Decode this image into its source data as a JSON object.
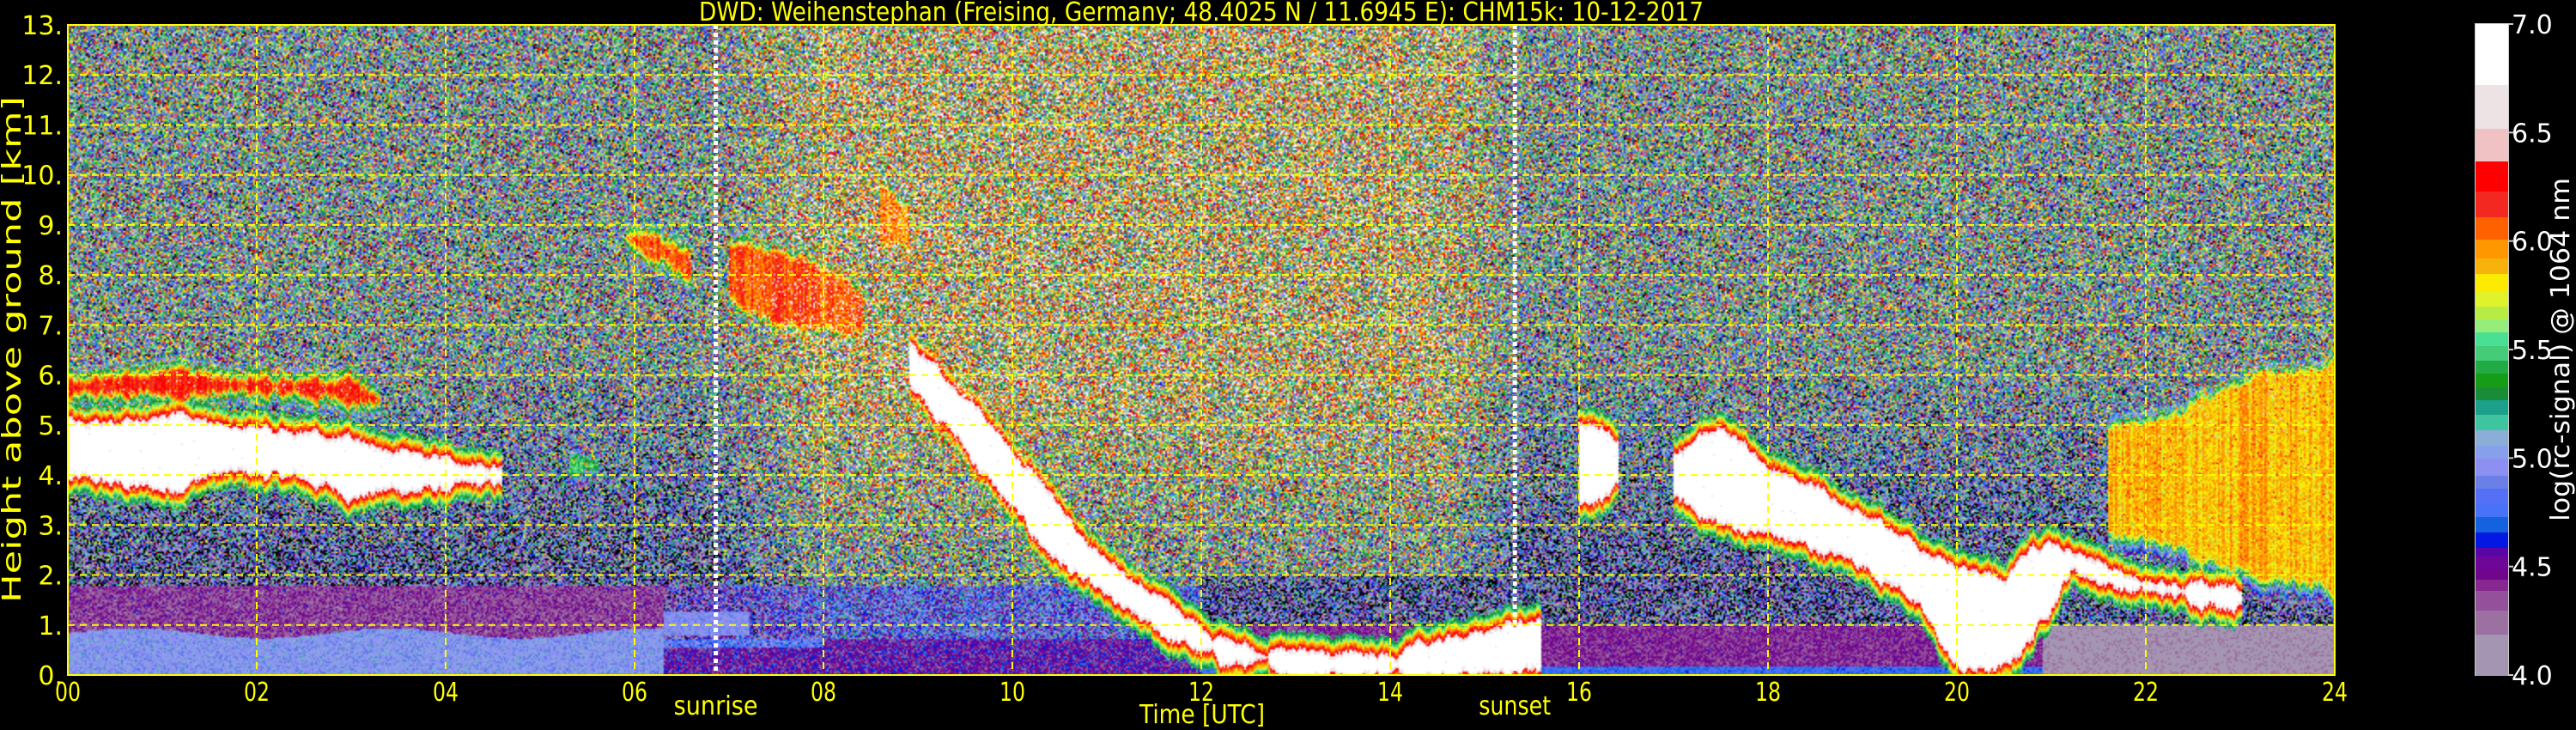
{
  "title": "DWD: Weihenstephan (Freising, Germany; 48.4025 N / 11.6945 E):    CHM15k: 10-12-2017",
  "chart_data": {
    "type": "heatmap",
    "title": "DWD: Weihenstephan (Freising, Germany; 48.4025 N / 11.6945 E):    CHM15k: 10-12-2017",
    "xlabel": "Time [UTC]",
    "ylabel": "Height above ground [km]",
    "xlim": [
      0,
      24
    ],
    "ylim": [
      0,
      13
    ],
    "xticks": [
      "00",
      "02",
      "04",
      "06",
      "08",
      "10",
      "12",
      "14",
      "16",
      "18",
      "20",
      "22",
      "24"
    ],
    "xtick_values": [
      0,
      2,
      4,
      6,
      8,
      10,
      12,
      14,
      16,
      18,
      20,
      22,
      24
    ],
    "yticks": [
      "0.",
      "1.",
      "2.",
      "3.",
      "4.",
      "5.",
      "6.",
      "7.",
      "8.",
      "9.",
      "10.",
      "11.",
      "12.",
      "13."
    ],
    "ytick_values": [
      0,
      1,
      2,
      3,
      4,
      5,
      6,
      7,
      8,
      9,
      10,
      11,
      12,
      13
    ],
    "grid": true,
    "annotations": [
      {
        "label": "sunrise",
        "time": 6.86
      },
      {
        "label": "sunset",
        "time": 15.32
      }
    ],
    "colorbar": {
      "label": "log(rc-signal) @ 1064 nm",
      "range": [
        4.0,
        7.0
      ],
      "ticks": [
        "4.0",
        "4.5",
        "5.0",
        "5.5",
        "6.0",
        "6.5",
        "7.0"
      ],
      "tick_values": [
        4.0,
        4.5,
        5.0,
        5.5,
        6.0,
        6.5,
        7.0
      ],
      "stops": [
        [
          4.0,
          4.19,
          "#a496b2"
        ],
        [
          4.19,
          4.3,
          "#9c70a0"
        ],
        [
          4.3,
          4.39,
          "#94509a"
        ],
        [
          4.39,
          4.44,
          "#862890"
        ],
        [
          4.44,
          4.49,
          "#70068c"
        ],
        [
          4.49,
          4.55,
          "#6e0698"
        ],
        [
          4.55,
          4.59,
          "#5a06a6"
        ],
        [
          4.59,
          4.66,
          "#0418e4"
        ],
        [
          4.66,
          4.73,
          "#1462e0"
        ],
        [
          4.73,
          4.79,
          "#4872f8"
        ],
        [
          4.79,
          4.86,
          "#5470f4"
        ],
        [
          4.86,
          4.92,
          "#6a80e6"
        ],
        [
          4.92,
          5.0,
          "#8c90f0"
        ],
        [
          5.0,
          5.06,
          "#88a0ec"
        ],
        [
          5.06,
          5.13,
          "#8aaed8"
        ],
        [
          5.13,
          5.2,
          "#3fc4a0"
        ],
        [
          5.2,
          5.27,
          "#1ca08a"
        ],
        [
          5.27,
          5.33,
          "#198c38"
        ],
        [
          5.33,
          5.39,
          "#169c16"
        ],
        [
          5.39,
          5.45,
          "#22aa44"
        ],
        [
          5.45,
          5.52,
          "#44cc78"
        ],
        [
          5.52,
          5.58,
          "#4ae094"
        ],
        [
          5.58,
          5.64,
          "#96ee7a"
        ],
        [
          5.64,
          5.7,
          "#b7ec44"
        ],
        [
          5.7,
          5.77,
          "#dff22c"
        ],
        [
          5.77,
          5.85,
          "#fcea00"
        ],
        [
          5.85,
          5.92,
          "#f8b20c"
        ],
        [
          5.92,
          6.01,
          "#ff9800"
        ],
        [
          6.01,
          6.11,
          "#ff6000"
        ],
        [
          6.11,
          6.23,
          "#f32820"
        ],
        [
          6.23,
          6.37,
          "#ff0000"
        ],
        [
          6.37,
          6.52,
          "#f0c2c4"
        ],
        [
          6.52,
          6.72,
          "#ede3e5"
        ],
        [
          6.72,
          7.0,
          "#ffffff"
        ]
      ]
    },
    "cloud_layers": [
      {
        "intensity": 6.9,
        "points": [
          [
            0,
            3.9,
            5.2
          ],
          [
            0.5,
            3.8,
            5.1
          ],
          [
            1,
            3.7,
            5.2
          ],
          [
            1.5,
            4.0,
            5.1
          ],
          [
            2,
            4.0,
            5.0
          ],
          [
            2.5,
            3.9,
            4.9
          ],
          [
            3,
            3.6,
            4.7
          ],
          [
            3.5,
            3.7,
            4.5
          ],
          [
            4,
            3.7,
            4.4
          ],
          [
            4.6,
            3.8,
            4.2
          ]
        ]
      },
      {
        "intensity": 6.3,
        "points": [
          [
            0,
            5.5,
            6.0
          ],
          [
            1,
            5.6,
            6.1
          ],
          [
            2,
            5.6,
            6.0
          ],
          [
            3,
            5.5,
            5.9
          ],
          [
            3.3,
            5.4,
            5.6
          ]
        ]
      },
      {
        "intensity": 5.6,
        "points": [
          [
            5.3,
            3.9,
            4.5
          ],
          [
            5.6,
            4.0,
            4.4
          ]
        ]
      },
      {
        "intensity": 6.2,
        "points": [
          [
            5.9,
            8.5,
            9.0
          ],
          [
            6.3,
            8.2,
            8.8
          ],
          [
            6.6,
            7.9,
            8.4
          ]
        ]
      },
      {
        "intensity": 6.2,
        "points": [
          [
            7.0,
            7.6,
            8.6
          ],
          [
            7.5,
            7.0,
            8.5
          ],
          [
            8.0,
            6.8,
            8.3
          ],
          [
            8.4,
            6.9,
            7.6
          ]
        ]
      },
      {
        "intensity": 6.1,
        "points": [
          [
            8.6,
            8.6,
            9.9
          ],
          [
            8.9,
            8.5,
            9.4
          ]
        ]
      },
      {
        "intensity": 6.9,
        "points": [
          [
            8.9,
            5.9,
            6.6
          ],
          [
            9.3,
            5.0,
            5.9
          ],
          [
            9.7,
            4.0,
            5.2
          ],
          [
            10.2,
            2.8,
            4.1
          ],
          [
            10.7,
            1.9,
            2.9
          ],
          [
            11.2,
            1.2,
            2.1
          ],
          [
            11.7,
            0.7,
            1.4
          ],
          [
            12.2,
            0.25,
            0.75
          ],
          [
            13,
            0.05,
            0.45
          ],
          [
            14,
            0.05,
            0.4
          ],
          [
            15,
            0.05,
            0.9
          ],
          [
            15.6,
            0.05,
            1.2
          ]
        ]
      },
      {
        "intensity": 6.9,
        "points": [
          [
            16.0,
            3.5,
            5.0
          ],
          [
            16.4,
            3.7,
            4.8
          ]
        ]
      },
      {
        "intensity": 6.9,
        "points": [
          [
            17.0,
            3.5,
            4.5
          ],
          [
            17.5,
            3.0,
            5.0
          ],
          [
            18,
            2.8,
            4.2
          ],
          [
            18.5,
            2.5,
            3.8
          ],
          [
            19,
            2.2,
            3.2
          ],
          [
            19.5,
            1.6,
            2.7
          ],
          [
            20,
            0.1,
            2.2
          ],
          [
            20.5,
            0.1,
            2.0
          ],
          [
            20.8,
            0.8,
            2.6
          ],
          [
            21.2,
            2.1,
            2.5
          ],
          [
            21.8,
            1.7,
            2.0
          ],
          [
            22.5,
            1.5,
            1.8
          ],
          [
            23,
            1.4,
            1.7
          ]
        ]
      },
      {
        "intensity": 6.0,
        "points": [
          [
            21.6,
            2.8,
            5.0
          ],
          [
            22.3,
            2.5,
            5.3
          ],
          [
            23.2,
            2.0,
            6.0
          ],
          [
            24,
            1.5,
            6.4
          ]
        ]
      }
    ]
  }
}
